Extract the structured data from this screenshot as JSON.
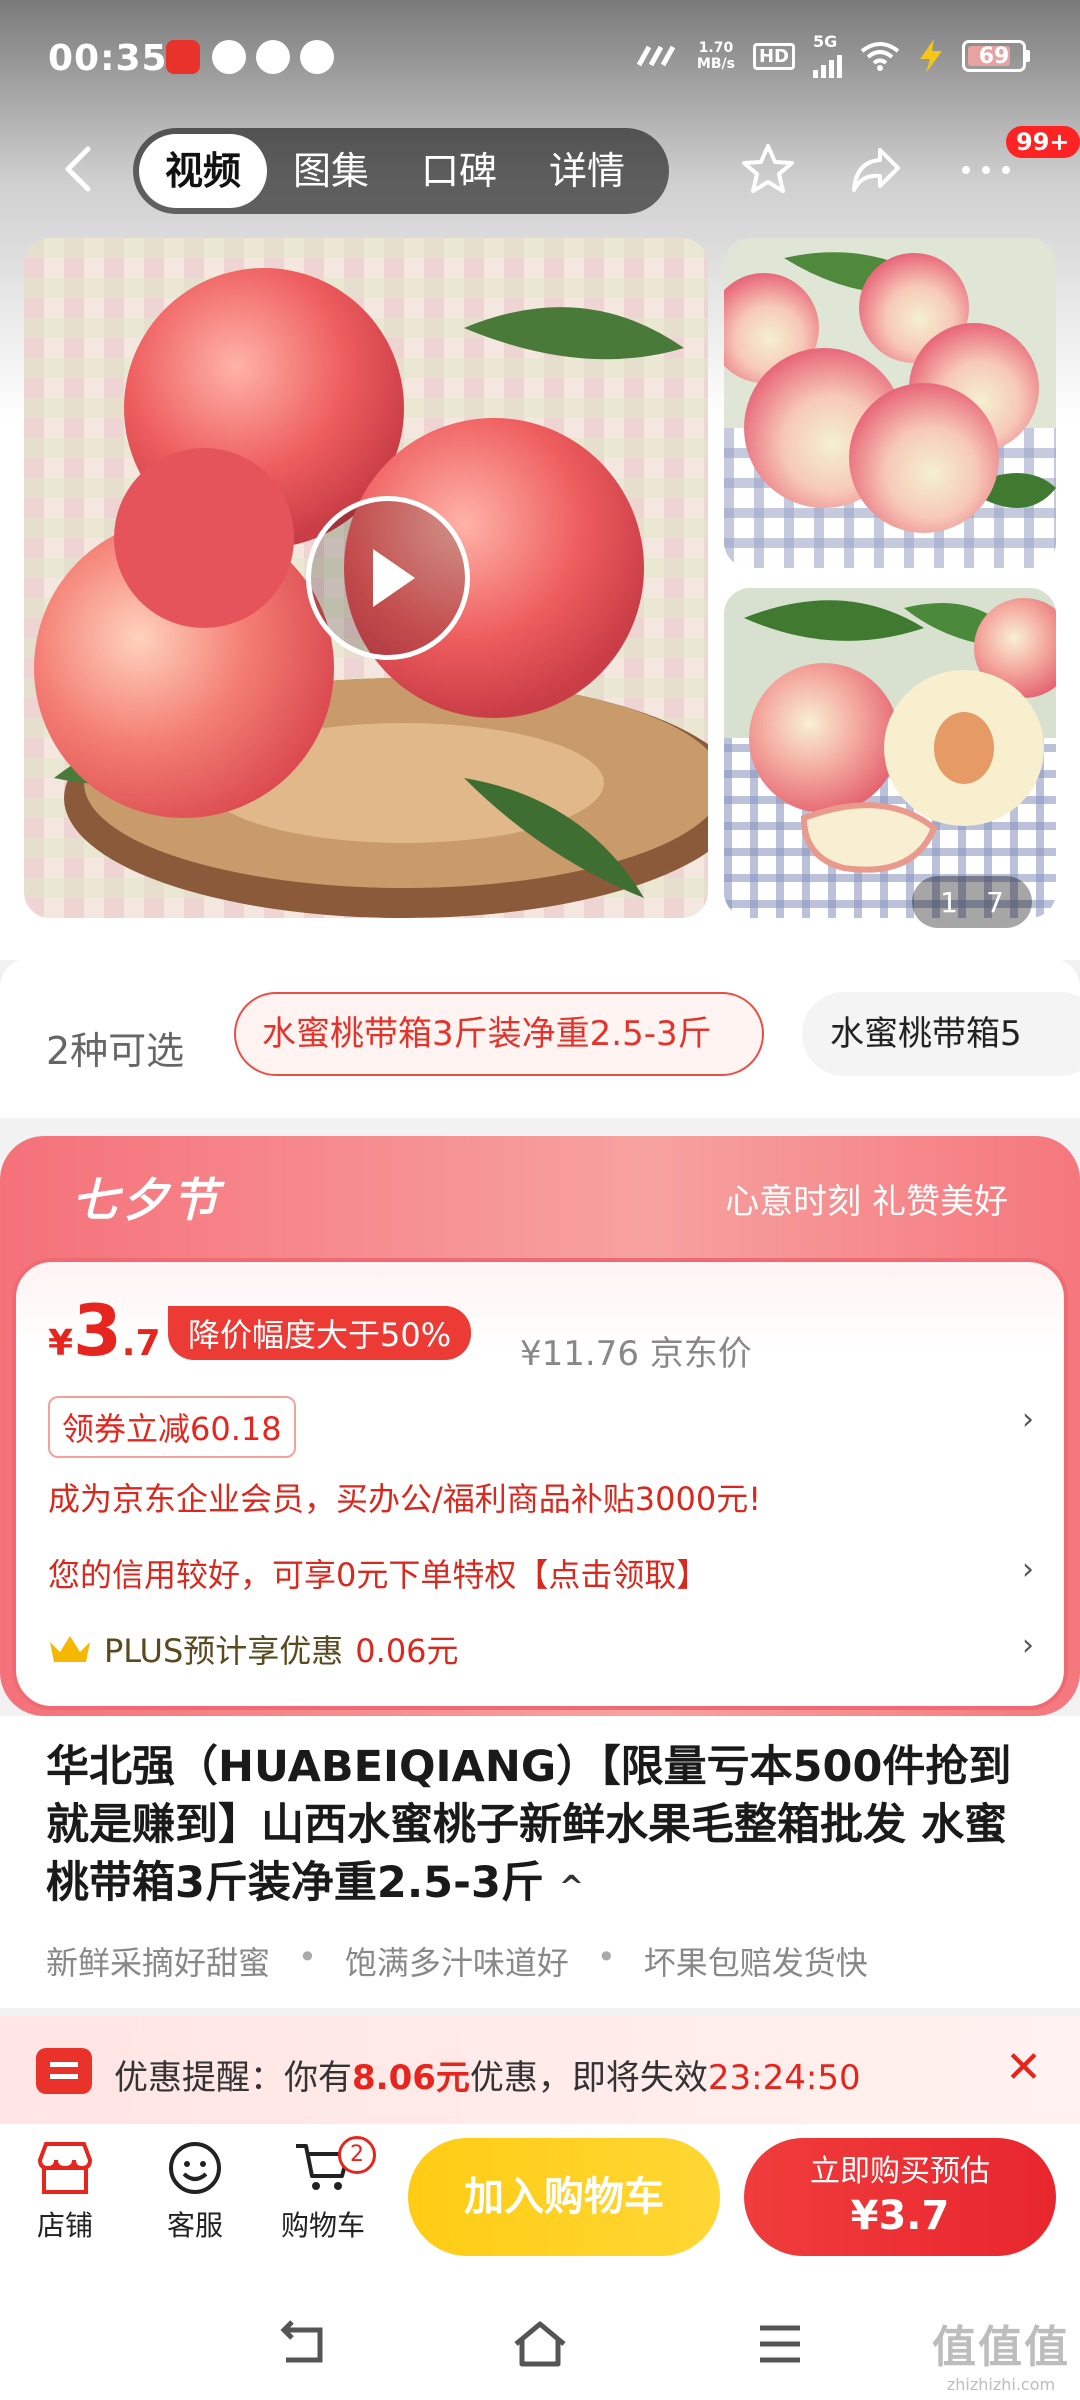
{
  "status_bar": {
    "time": "00:35",
    "net_speed_top": "1.70",
    "net_speed_bottom": "MB/s",
    "hd": "HD",
    "signal": "5G",
    "battery": "69"
  },
  "nav": {
    "tabs": [
      "视频",
      "图集",
      "口碑",
      "详情"
    ],
    "active_tab": "视频",
    "more_badge": "99+"
  },
  "gallery": {
    "counter_current": "1",
    "counter_total": "7"
  },
  "variants": {
    "count_label": "2种可选",
    "options": [
      "水蜜桃带箱3斤装净重2.5-3斤",
      "水蜜桃带箱5"
    ]
  },
  "promo": {
    "festival": "七夕节",
    "slogan": "心意时刻 礼赞美好",
    "currency": "¥",
    "price_int": "3",
    "price_dec": ".7",
    "drop_tag": "降价幅度大于50%",
    "jd_price": "¥11.76 京东价",
    "coupon": "领券立减60.18",
    "enterprise_line": "成为京东企业会员，买办公/福利商品补贴3000元!",
    "credit_line": "您的信用较好，可享0元下单特权【点击领取】",
    "plus_prefix": "PLUS预计享优惠",
    "plus_amount": "0.06元"
  },
  "product": {
    "title": "华北强（HUABEIQIANG）【限量亏本500件抢到就是赚到】山西水蜜桃子新鲜水果毛整箱批发 水蜜桃带箱3斤装净重2.5-3斤",
    "features": [
      "新鲜采摘好甜蜜",
      "饱满多汁味道好",
      "坏果包赔发货快"
    ]
  },
  "reminder": {
    "prefix": "优惠提醒：你有",
    "amount": "8.06元",
    "middle": "优惠，即将失效",
    "timer": "23:24:50"
  },
  "bottom_bar": {
    "shop": "店铺",
    "service": "客服",
    "cart": "购物车",
    "cart_count": "2",
    "add_to_cart": "加入购物车",
    "buy_now_line1": "立即购买预估",
    "buy_now_price": "¥3.7"
  },
  "watermark": {
    "mark": "值值值",
    "site": "zhizhizhi.com"
  }
}
